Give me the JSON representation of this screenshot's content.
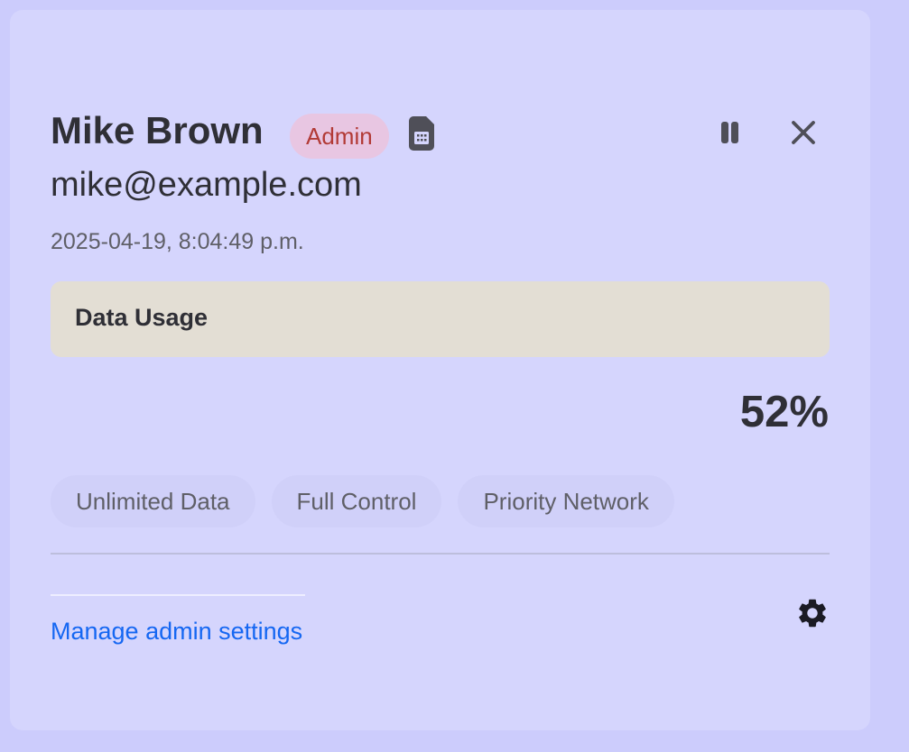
{
  "user": {
    "name": "Mike Brown",
    "role": "Admin",
    "email": "mike@example.com",
    "timestamp": "2025-04-19, 8:04:49 p.m."
  },
  "icons": {
    "sim": "sim-card-icon",
    "pause": "pause-icon",
    "close": "close-icon",
    "settings": "gear-icon"
  },
  "usage": {
    "title": "Data Usage",
    "value": "52%"
  },
  "features": [
    "Unlimited Data",
    "Full Control",
    "Priority Network"
  ],
  "footer": {
    "link_label": "Manage admin settings"
  },
  "colors": {
    "background": "#ccccfc",
    "card": "#d5d5fd",
    "role_badge_bg": "#e8c6e2",
    "role_badge_text": "#b23a36",
    "usage_panel": "#e3ded4",
    "link": "#1567f2"
  }
}
